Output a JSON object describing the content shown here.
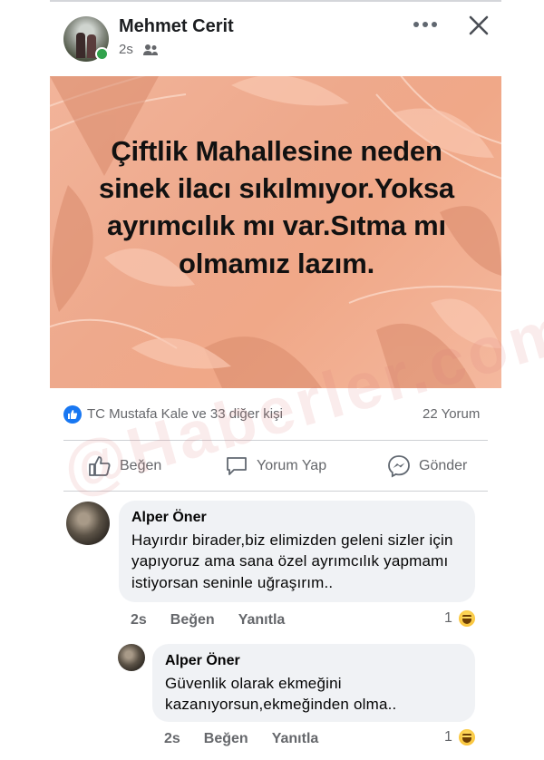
{
  "post": {
    "author": "Mehmet Cerit",
    "time": "2s",
    "audience_icon": "friends-icon",
    "hero_text": "Çiftlik Mahallesine neden sinek ilacı sıkılmıyor.Yoksa ayrımcılık mı var.Sıtma mı olmamız lazım.",
    "hero_colors": {
      "background": "#eea98c",
      "leaf": "#f7c6b0"
    }
  },
  "reactions": {
    "reactors": "TC Mustafa Kale ve 33 diğer kişi",
    "comment_count": "22 Yorum"
  },
  "actions": {
    "like": "Beğen",
    "comment": "Yorum Yap",
    "send": "Gönder"
  },
  "comments": [
    {
      "name": "Alper Öner",
      "text": "Hayırdır birader,biz elimizden geleni sizler için yapıyoruz ama sana özel ayrımcılık yapmamı istiyorsan seninle uğraşırım..",
      "time": "2s",
      "like": "Beğen",
      "reply": "Yanıtla",
      "reaction_count": "1"
    },
    {
      "name": "Alper Öner",
      "text": "Güvenlik olarak ekmeğini kazanıyorsun,ekmeğinden olma..",
      "time": "2s",
      "like": "Beğen",
      "reply": "Yanıtla",
      "reaction_count": "1"
    }
  ],
  "watermark": "@Haberler.com",
  "accent_color": "#1877f2"
}
